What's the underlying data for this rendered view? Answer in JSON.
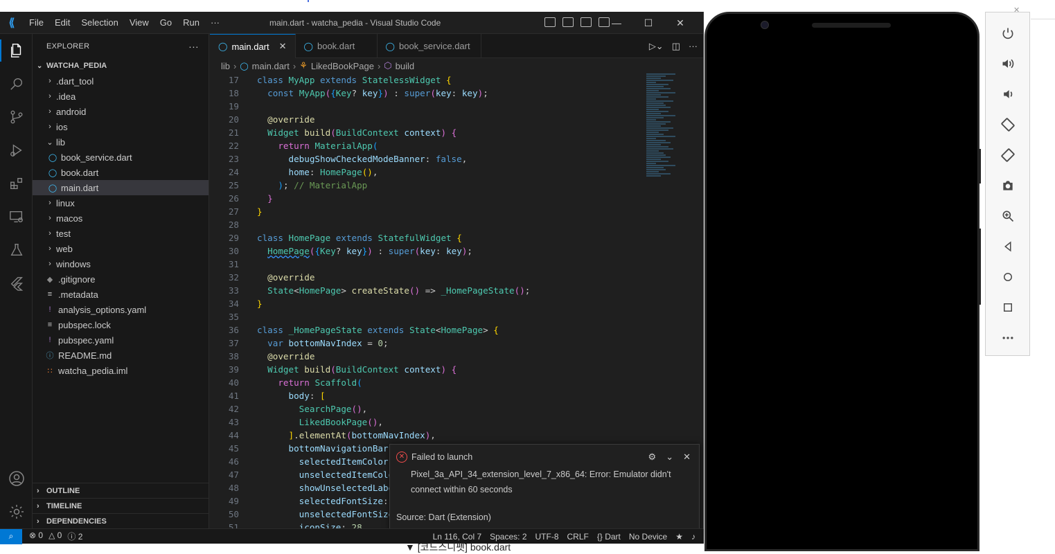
{
  "window": {
    "title": "main.dart - watcha_pedia - Visual Studio Code",
    "menu": [
      "File",
      "Edit",
      "Selection",
      "View",
      "Go",
      "Run",
      "···"
    ]
  },
  "sidebar": {
    "header": "EXPLORER",
    "more": "···",
    "root": "WATCHA_PEDIA",
    "items": [
      {
        "label": ".dart_tool",
        "type": "folder"
      },
      {
        "label": ".idea",
        "type": "folder"
      },
      {
        "label": "android",
        "type": "folder"
      },
      {
        "label": "ios",
        "type": "folder"
      },
      {
        "label": "lib",
        "type": "folder-open"
      },
      {
        "label": "book_service.dart",
        "type": "dart"
      },
      {
        "label": "book.dart",
        "type": "dart"
      },
      {
        "label": "main.dart",
        "type": "dart"
      },
      {
        "label": "linux",
        "type": "folder"
      },
      {
        "label": "macos",
        "type": "folder"
      },
      {
        "label": "test",
        "type": "folder"
      },
      {
        "label": "web",
        "type": "folder"
      },
      {
        "label": "windows",
        "type": "folder"
      },
      {
        "label": ".gitignore",
        "type": "git"
      },
      {
        "label": ".metadata",
        "type": "lines"
      },
      {
        "label": "analysis_options.yaml",
        "type": "yaml"
      },
      {
        "label": "pubspec.lock",
        "type": "lines"
      },
      {
        "label": "pubspec.yaml",
        "type": "yaml"
      },
      {
        "label": "README.md",
        "type": "info"
      },
      {
        "label": "watcha_pedia.iml",
        "type": "rss"
      }
    ],
    "sections": [
      "OUTLINE",
      "TIMELINE",
      "DEPENDENCIES"
    ]
  },
  "tabs": [
    "main.dart",
    "book.dart",
    "book_service.dart"
  ],
  "breadcrumb": [
    "lib",
    "main.dart",
    "LikedBookPage",
    "build"
  ],
  "code": {
    "line_numbers": [
      "17",
      "18",
      "19",
      "20",
      "21",
      "22",
      "23",
      "24",
      "25",
      "26",
      "27",
      "28",
      "29",
      "30",
      "31",
      "32",
      "33",
      "34",
      "35",
      "36",
      "37",
      "38",
      "39",
      "40",
      "41",
      "42",
      "43",
      "44",
      "45",
      "46",
      "47",
      "48",
      "49",
      "50",
      "51"
    ]
  },
  "notification": {
    "title": "Failed to launch",
    "message": "Pixel_3a_API_34_extension_level_7_x86_64: Error: Emulator didn't connect within 60 seconds",
    "source": "Source: Dart (Extension)"
  },
  "statusbar": {
    "errors": "0",
    "warnings": "0",
    "info": "2",
    "position": "Ln 116, Col 7",
    "spaces": "Spaces: 2",
    "encoding": "UTF-8",
    "eol": "CRLF",
    "language": "Dart",
    "device": "No Device"
  },
  "background_text": "▼ [코드스니펫] book.dart",
  "colors": {
    "accent": "#0078d4",
    "error": "#f14c4c",
    "dart": "#40c4ff"
  }
}
